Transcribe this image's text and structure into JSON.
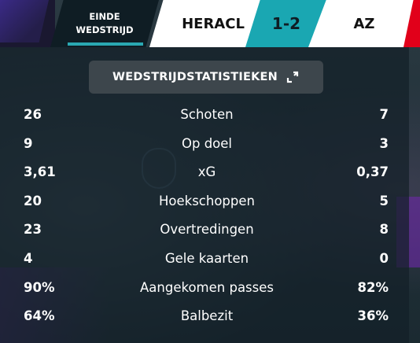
{
  "scoreboard": {
    "status_line1": "EINDE",
    "status_line2": "WEDSTRIJD",
    "home_team": "HERACL",
    "score": "1-2",
    "away_team": "AZ",
    "colors": {
      "score_bg": "#1aa7b2",
      "away_accent": "#e1001a",
      "status_bg": "#0f1d24"
    }
  },
  "stats": {
    "title": "WEDSTRIJDSTATISTIEKEN",
    "expand_icon": "expand-icon",
    "rows": [
      {
        "home": "26",
        "label": "Schoten",
        "away": "7"
      },
      {
        "home": "9",
        "label": "Op doel",
        "away": "3"
      },
      {
        "home": "3,61",
        "label": "xG",
        "away": "0,37"
      },
      {
        "home": "20",
        "label": "Hoekschoppen",
        "away": "5"
      },
      {
        "home": "23",
        "label": "Overtredingen",
        "away": "8"
      },
      {
        "home": "4",
        "label": "Gele kaarten",
        "away": "0"
      },
      {
        "home": "90%",
        "label": "Aangekomen passes",
        "away": "82%"
      },
      {
        "home": "64%",
        "label": "Balbezit",
        "away": "36%"
      }
    ]
  }
}
